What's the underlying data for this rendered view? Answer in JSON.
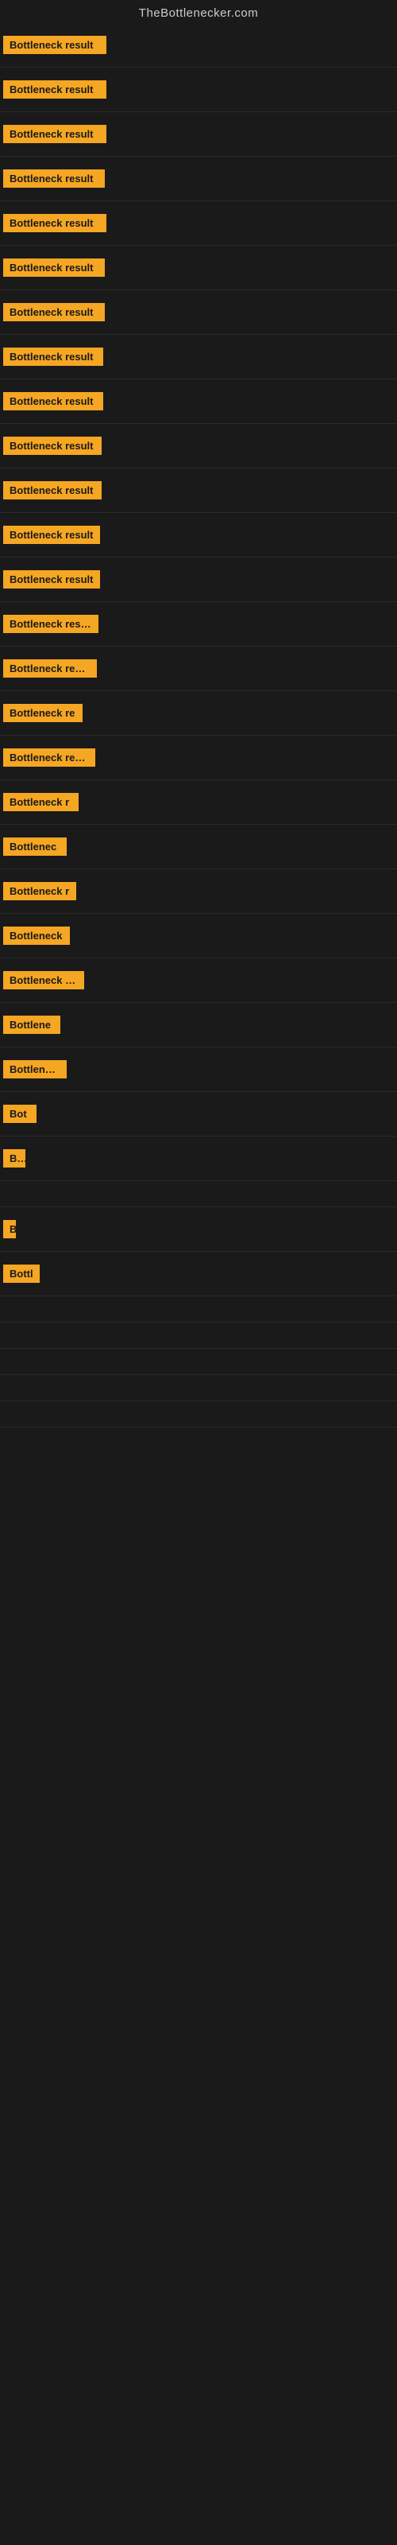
{
  "header": {
    "title": "TheBottlenecker.com"
  },
  "items": [
    {
      "label": "Bottleneck result",
      "width": 130
    },
    {
      "label": "Bottleneck result",
      "width": 130
    },
    {
      "label": "Bottleneck result",
      "width": 130
    },
    {
      "label": "Bottleneck result",
      "width": 128
    },
    {
      "label": "Bottleneck result",
      "width": 130
    },
    {
      "label": "Bottleneck result",
      "width": 128
    },
    {
      "label": "Bottleneck result",
      "width": 128
    },
    {
      "label": "Bottleneck result",
      "width": 126
    },
    {
      "label": "Bottleneck result",
      "width": 126
    },
    {
      "label": "Bottleneck result",
      "width": 124
    },
    {
      "label": "Bottleneck result",
      "width": 124
    },
    {
      "label": "Bottleneck result",
      "width": 122
    },
    {
      "label": "Bottleneck result",
      "width": 122
    },
    {
      "label": "Bottleneck result",
      "width": 120
    },
    {
      "label": "Bottleneck result",
      "width": 118
    },
    {
      "label": "Bottleneck re",
      "width": 100
    },
    {
      "label": "Bottleneck result",
      "width": 116
    },
    {
      "label": "Bottleneck r",
      "width": 95
    },
    {
      "label": "Bottlenec",
      "width": 80
    },
    {
      "label": "Bottleneck r",
      "width": 92
    },
    {
      "label": "Bottleneck",
      "width": 84
    },
    {
      "label": "Bottleneck res",
      "width": 102
    },
    {
      "label": "Bottlene",
      "width": 72
    },
    {
      "label": "Bottleneck",
      "width": 80
    },
    {
      "label": "Bot",
      "width": 42
    },
    {
      "label": "Bo",
      "width": 28
    },
    {
      "label": "",
      "width": 0
    },
    {
      "label": "B",
      "width": 16
    },
    {
      "label": "Bottl",
      "width": 46
    },
    {
      "label": "",
      "width": 0
    },
    {
      "label": "",
      "width": 0
    },
    {
      "label": "",
      "width": 0
    },
    {
      "label": "",
      "width": 0
    },
    {
      "label": "",
      "width": 0
    }
  ]
}
